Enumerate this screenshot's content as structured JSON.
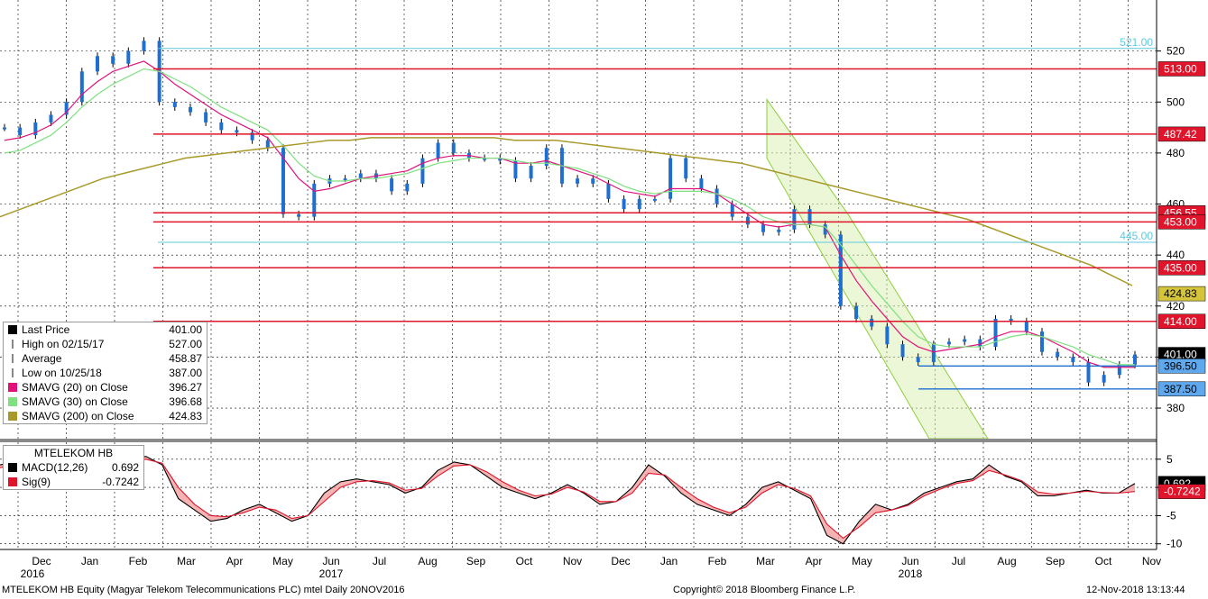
{
  "chart_data": [
    {
      "type": "candlestick",
      "panel": "price",
      "ylim": [
        368,
        540
      ],
      "y_ticks": [
        380,
        400,
        420,
        440,
        460,
        480,
        500,
        520
      ],
      "x_ticks": [
        "Dec",
        "Jan",
        "Feb",
        "Mar",
        "Apr",
        "May",
        "Jun",
        "Jul",
        "Aug",
        "Sep",
        "Oct",
        "Nov",
        "Dec",
        "Jan",
        "Feb",
        "Mar",
        "Apr",
        "May",
        "Jun",
        "Jul",
        "Aug",
        "Sep",
        "Oct",
        "Nov"
      ],
      "year_labels": [
        {
          "label": "2016",
          "under": "Dec"
        },
        {
          "label": "2017",
          "under": "Jun"
        },
        {
          "label": "2018",
          "under": "Jun"
        }
      ],
      "grid": true,
      "series": [
        {
          "name": "Last Price",
          "color": "#1f6fd0",
          "values": [
            490,
            487,
            492,
            495,
            500,
            512,
            518,
            515,
            520,
            524,
            500,
            498,
            496,
            492,
            489,
            488,
            485,
            482,
            456,
            455,
            468,
            470,
            470,
            472,
            470,
            465,
            468,
            478,
            484,
            480,
            478,
            478,
            477,
            470,
            475,
            482,
            468,
            470,
            468,
            462,
            458,
            462,
            462,
            478,
            470,
            466,
            460,
            455,
            452,
            449,
            450,
            458,
            452,
            448,
            420,
            415,
            412,
            405,
            400,
            398,
            405,
            406,
            407,
            404,
            415,
            414,
            410,
            402,
            400,
            398,
            390,
            393,
            397,
            401
          ]
        },
        {
          "name": "SMAVG (20)",
          "color": "#e0127a",
          "values": [
            485,
            486,
            488,
            491,
            496,
            503,
            508,
            512,
            514,
            516,
            512,
            507,
            503,
            499,
            495,
            492,
            489,
            486,
            478,
            470,
            465,
            466,
            468,
            470,
            471,
            472,
            473,
            476,
            478,
            479,
            479,
            478,
            478,
            476,
            476,
            477,
            475,
            473,
            471,
            468,
            465,
            464,
            463,
            466,
            466,
            466,
            464,
            460,
            456,
            452,
            451,
            452,
            452,
            451,
            440,
            430,
            422,
            415,
            408,
            404,
            402,
            403,
            404,
            405,
            408,
            410,
            410,
            408,
            405,
            402,
            398,
            396,
            396,
            396
          ]
        },
        {
          "name": "SMAVG (30)",
          "color": "#7ee07e",
          "values": [
            480,
            481,
            484,
            487,
            492,
            498,
            503,
            507,
            510,
            513,
            512,
            509,
            506,
            502,
            498,
            495,
            492,
            489,
            483,
            476,
            471,
            469,
            469,
            470,
            470,
            471,
            472,
            474,
            476,
            477,
            478,
            478,
            478,
            477,
            476,
            476,
            475,
            474,
            472,
            470,
            467,
            465,
            464,
            465,
            465,
            465,
            464,
            462,
            459,
            455,
            453,
            452,
            452,
            451,
            444,
            436,
            428,
            421,
            414,
            408,
            405,
            404,
            404,
            404,
            406,
            408,
            409,
            408,
            406,
            404,
            401,
            399,
            397,
            397
          ]
        },
        {
          "name": "SMAVG (200)",
          "color": "#a89a2a",
          "values": [
            455,
            458,
            461,
            464,
            467,
            470,
            472,
            474,
            476,
            478,
            479,
            480,
            481,
            482,
            483,
            484,
            485,
            485,
            486,
            486,
            486,
            486,
            486,
            486,
            486,
            485,
            485,
            485,
            484,
            483,
            482,
            481,
            480,
            479,
            478,
            477,
            476,
            474,
            472,
            470,
            468,
            466,
            464,
            462,
            460,
            458,
            456,
            454,
            451,
            448,
            445,
            442,
            439,
            436,
            432,
            428
          ]
        }
      ],
      "horizontal_lines": [
        {
          "value": 521.0,
          "label": "521.00",
          "color": "#5fc8dc",
          "style": "text"
        },
        {
          "value": 513.0,
          "label": "513.00",
          "color": "#e0142a",
          "style": "box"
        },
        {
          "value": 487.42,
          "label": "487.42",
          "color": "#e0142a",
          "style": "box"
        },
        {
          "value": 456.55,
          "label": "456.55",
          "color": "#e0142a",
          "style": "box"
        },
        {
          "value": 453.0,
          "label": "453.00",
          "color": "#e0142a",
          "style": "box"
        },
        {
          "value": 445.0,
          "label": "445.00",
          "color": "#5fc8dc",
          "style": "text"
        },
        {
          "value": 435.0,
          "label": "435.00",
          "color": "#e0142a",
          "style": "box"
        },
        {
          "value": 424.83,
          "label": "424.83",
          "color": "#a89a2a",
          "style": "box"
        },
        {
          "value": 414.0,
          "label": "414.00",
          "color": "#e0142a",
          "style": "box"
        },
        {
          "value": 401.0,
          "label": "401.00",
          "color": "#000000",
          "style": "box"
        },
        {
          "value": 396.5,
          "label": "396.50",
          "color": "#1f6fd0",
          "style": "box"
        },
        {
          "value": 387.5,
          "label": "387.50",
          "color": "#1f6fd0",
          "style": "box"
        }
      ],
      "legend": {
        "placement": "bottom-left",
        "entries": [
          {
            "label": "Last Price",
            "value": "401.00",
            "marker": "square",
            "color": "#000000"
          },
          {
            "label": "High on 02/15/17",
            "value": "527.00",
            "marker": "T",
            "color": "#888888"
          },
          {
            "label": "Average",
            "value": "458.87",
            "marker": "dash",
            "color": "#888888"
          },
          {
            "label": "Low on 10/25/18",
            "value": "387.00",
            "marker": "inv-T",
            "color": "#888888"
          },
          {
            "label": "SMAVG (20)  on Close",
            "value": "396.27",
            "marker": "square",
            "color": "#e0127a"
          },
          {
            "label": "SMAVG (30)  on Close",
            "value": "396.68",
            "marker": "square",
            "color": "#7ee07e"
          },
          {
            "label": "SMAVG (200)  on Close",
            "value": "424.83",
            "marker": "square",
            "color": "#a89a2a"
          }
        ]
      }
    },
    {
      "type": "line",
      "panel": "macd",
      "title": "MTELEKOM HB",
      "ylim": [
        -11,
        8
      ],
      "y_ticks": [
        5,
        0,
        -5,
        -10
      ],
      "grid": true,
      "series": [
        {
          "name": "MACD(12,26)",
          "color": "#000000",
          "values": [
            4,
            4.5,
            5,
            5.2,
            5,
            4,
            3,
            4,
            5,
            5.5,
            4,
            -2,
            -4,
            -6,
            -5.5,
            -4,
            -3,
            -4.5,
            -6,
            -5,
            -1,
            1,
            1.5,
            1,
            0.5,
            -1,
            0,
            3,
            4.5,
            4,
            2,
            0,
            -1,
            -2,
            -1,
            0.5,
            -1,
            -3,
            -2.5,
            0,
            4,
            2,
            -1,
            -3,
            -4,
            -5,
            -3,
            0,
            1,
            -0.5,
            -2,
            -8.5,
            -10,
            -6,
            -3,
            -4,
            -3,
            -1,
            0,
            1,
            1.5,
            4,
            2,
            1,
            -1.5,
            -1.5,
            -1,
            -0.5,
            -1,
            -1,
            0.692
          ]
        },
        {
          "name": "Sig(9)",
          "color": "#e0142a",
          "values": [
            3.5,
            4,
            4.5,
            4.8,
            4.8,
            4.3,
            3.6,
            3.8,
            4.5,
            5,
            4.3,
            0,
            -3,
            -5,
            -5.2,
            -4.5,
            -3.5,
            -4,
            -5.5,
            -5,
            -2.5,
            0,
            1,
            1.2,
            0.8,
            -0.5,
            -0.2,
            2,
            3.8,
            4,
            2.8,
            1,
            -0.5,
            -1.5,
            -1.2,
            0,
            -0.8,
            -2.5,
            -2.5,
            -1,
            2.5,
            2.2,
            0,
            -2,
            -3.5,
            -4.5,
            -3.5,
            -1,
            0.5,
            -0.2,
            -1.5,
            -6.5,
            -9,
            -7,
            -4.5,
            -4,
            -3.2,
            -1.5,
            -0.3,
            0.7,
            1.2,
            3,
            2.2,
            1.2,
            -0.8,
            -1.2,
            -1,
            -0.7,
            -0.9,
            -1,
            -0.7242
          ]
        }
      ],
      "value_labels": [
        {
          "value": 0.692,
          "label": "0.692",
          "color": "#000000"
        },
        {
          "value": -0.7242,
          "label": "-0.7242",
          "color": "#e0142a"
        }
      ],
      "legend": {
        "placement": "top-left",
        "entries": [
          {
            "label": "MACD(12,26)",
            "value": "0.692",
            "color": "#000000"
          },
          {
            "label": "Sig(9)",
            "value": "-0.7242",
            "color": "#e0142a"
          }
        ]
      }
    }
  ],
  "footer": {
    "left": "MTELEKOM HB Equity (Magyar Telekom Telecommunications PLC) mtel  Daily 20NOV2016",
    "center": "Copyright© 2018 Bloomberg Finance L.P.",
    "right": "12-Nov-2018 13:13:44"
  }
}
